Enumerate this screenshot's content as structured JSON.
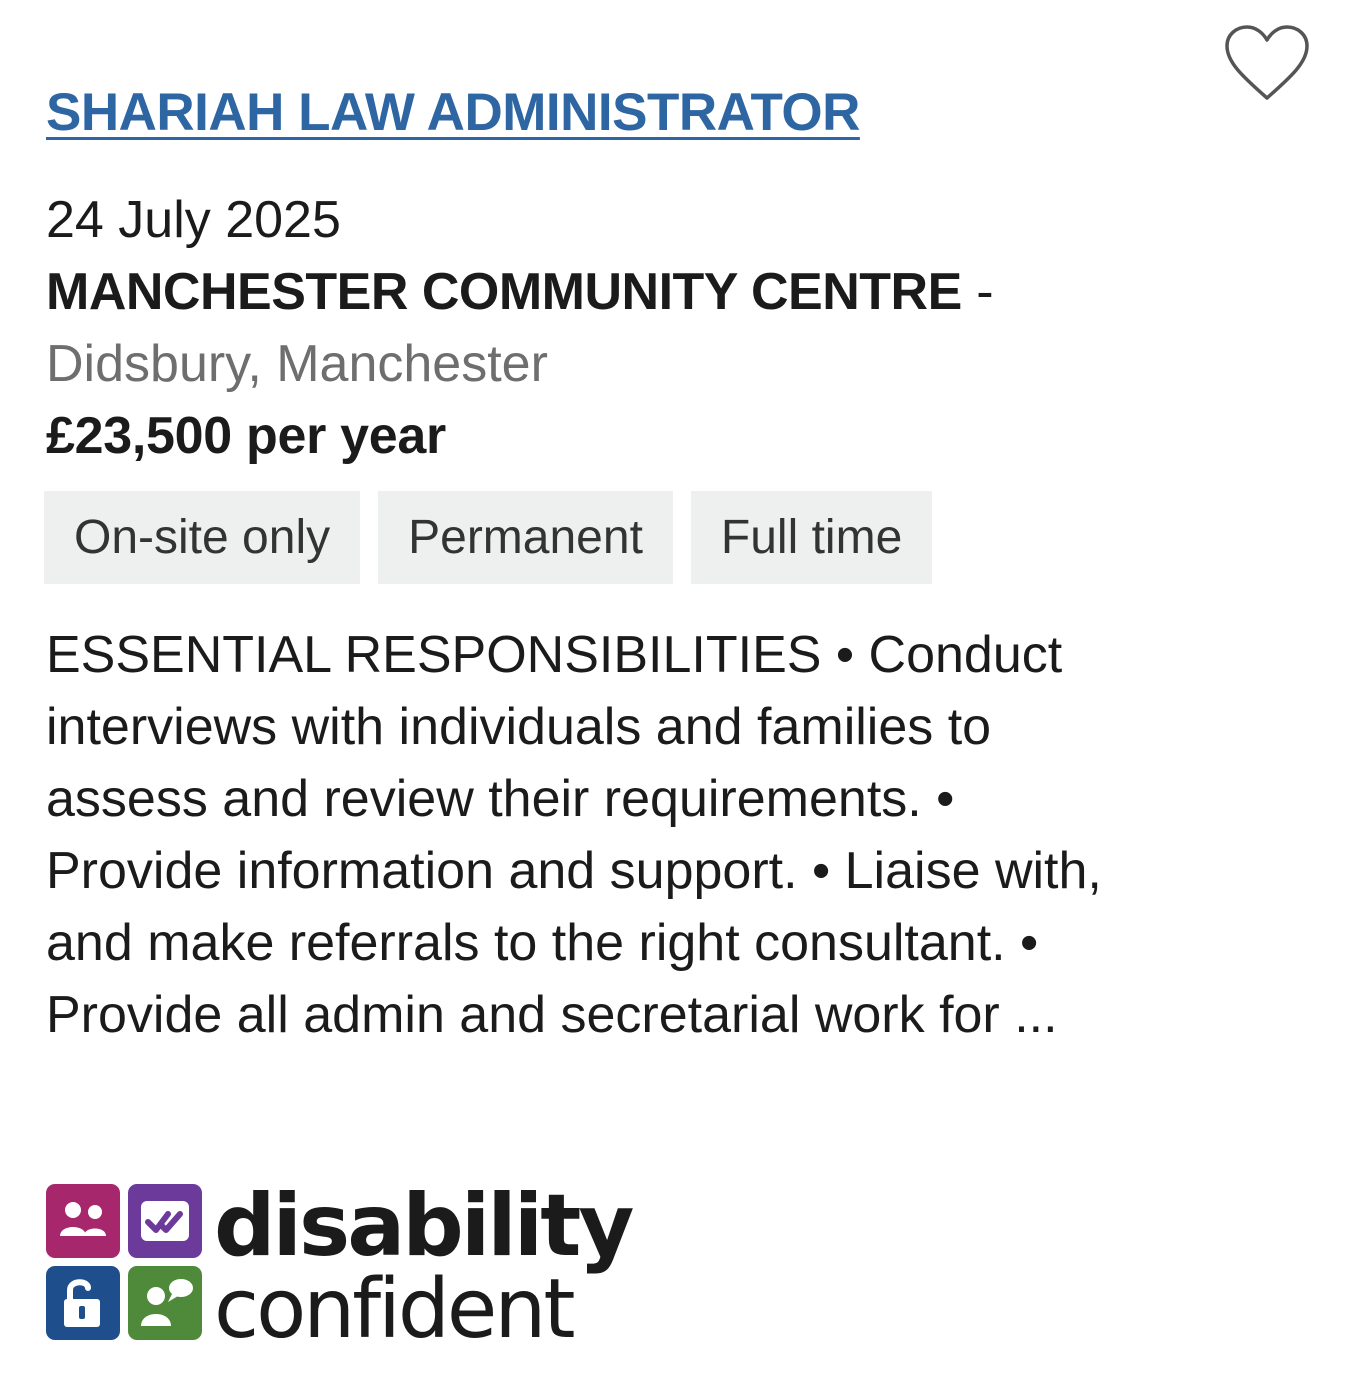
{
  "job": {
    "title": "SHARIAH LAW ADMINISTRATOR",
    "date": "24 July 2025",
    "employer": "MANCHESTER COMMUNITY CENTRE",
    "employer_separator": " -",
    "location": "Didsbury, Manchester",
    "salary": "£23,500 per year",
    "tags": [
      "On-site only",
      "Permanent",
      "Full time"
    ],
    "description": "ESSENTIAL RESPONSIBILITIES • Conduct interviews with individuals and families to assess and review their requirements. • Provide information and support. • Liaise with, and make referrals to the right consultant. • Provide all admin and secretarial work for ..."
  },
  "favourite": {
    "icon": "heart-outline-icon"
  },
  "badge": {
    "line1": "disability",
    "line2": "confident",
    "tile_colors": [
      "#a6276b",
      "#6b3a9a",
      "#1e4f8c",
      "#4f8a3a"
    ],
    "tile_icons": [
      "people-icon",
      "checkmarks-icon",
      "unlocked-padlock-icon",
      "speech-person-icon"
    ]
  },
  "colors": {
    "link": "#2e66a3",
    "tag_bg": "#eef0f0",
    "muted": "#6e6e6e"
  }
}
